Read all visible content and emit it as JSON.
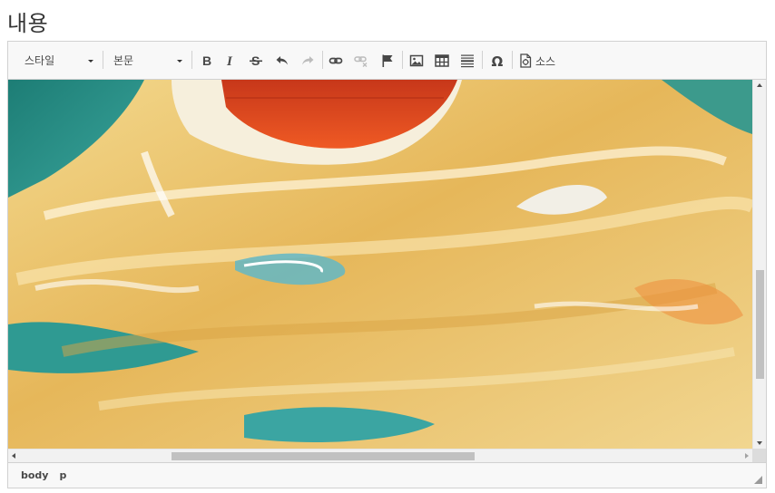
{
  "field": {
    "title": "내용"
  },
  "toolbar": {
    "style_combo": "스타일",
    "format_combo": "본문",
    "source_label": "소스"
  },
  "path": [
    "body",
    "p"
  ],
  "colors": {
    "toolbar_bg": "#f8f8f8",
    "border": "#d1d1d1",
    "icon": "#474747",
    "icon_disabled": "#bcbcbc"
  }
}
